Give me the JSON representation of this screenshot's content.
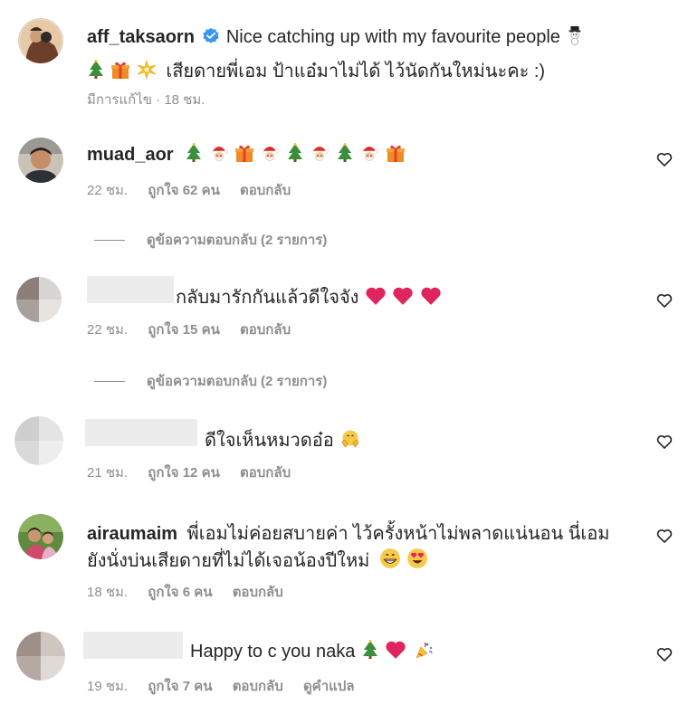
{
  "caption": {
    "username": "aff_taksaorn",
    "line1": "Nice catching up with my favourite people",
    "line2": "เสียดายพี่เอม ป้าแอ๋มาไม่ได้ ไว้นัดกันใหม่นะคะ :)",
    "meta": "มีการแก้ไข · 18 ชม."
  },
  "comments": [
    {
      "username": "muad_aor",
      "text": "",
      "time": "22 ชม.",
      "likes": "ถูกใจ 62 คน",
      "reply": "ตอบกลับ",
      "view_replies": "ดูข้อความตอบกลับ (2 รายการ)"
    },
    {
      "username": "",
      "text": "กลับมารักกันแล้วดีใจจัง",
      "time": "22 ชม.",
      "likes": "ถูกใจ 15 คน",
      "reply": "ตอบกลับ",
      "view_replies": "ดูข้อความตอบกลับ (2 รายการ)"
    },
    {
      "username": "",
      "text": "ดีใจเห็นหมวดอ๋อ",
      "time": "21 ชม.",
      "likes": "ถูกใจ 12 คน",
      "reply": "ตอบกลับ"
    },
    {
      "username": "airaumaim",
      "text_line1": "พี่เอมไม่ค่อยสบายค่า ไว้ครั้งหน้าไม่พลาดแน่นอน นี่เอม",
      "text_line2": "ยังนั่งบ่นเสียดายที่ไม่ได้เจอน้องปีใหม่",
      "time": "18 ชม.",
      "likes": "ถูกใจ 6 คน",
      "reply": "ตอบกลับ"
    },
    {
      "username": "",
      "text": "Happy to c you naka",
      "time": "19 ชม.",
      "likes": "ถูกใจ 7 คน",
      "reply": "ตอบกลับ",
      "translate": "ดูคำแปล"
    }
  ],
  "icons": {
    "verified": "verified-badge-icon",
    "heart": "heart-outline-icon",
    "accent": "#3897f0",
    "heart_red": "#e0245e"
  }
}
